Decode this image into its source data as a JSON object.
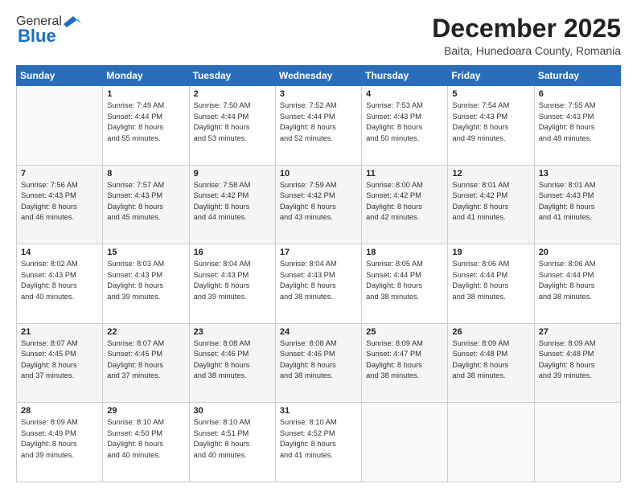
{
  "logo": {
    "line1": "General",
    "line2": "Blue"
  },
  "header": {
    "month": "December 2025",
    "location": "Baita, Hunedoara County, Romania"
  },
  "days_of_week": [
    "Sunday",
    "Monday",
    "Tuesday",
    "Wednesday",
    "Thursday",
    "Friday",
    "Saturday"
  ],
  "weeks": [
    [
      {
        "day": "",
        "info": ""
      },
      {
        "day": "1",
        "info": "Sunrise: 7:49 AM\nSunset: 4:44 PM\nDaylight: 8 hours\nand 55 minutes."
      },
      {
        "day": "2",
        "info": "Sunrise: 7:50 AM\nSunset: 4:44 PM\nDaylight: 8 hours\nand 53 minutes."
      },
      {
        "day": "3",
        "info": "Sunrise: 7:52 AM\nSunset: 4:44 PM\nDaylight: 8 hours\nand 52 minutes."
      },
      {
        "day": "4",
        "info": "Sunrise: 7:53 AM\nSunset: 4:43 PM\nDaylight: 8 hours\nand 50 minutes."
      },
      {
        "day": "5",
        "info": "Sunrise: 7:54 AM\nSunset: 4:43 PM\nDaylight: 8 hours\nand 49 minutes."
      },
      {
        "day": "6",
        "info": "Sunrise: 7:55 AM\nSunset: 4:43 PM\nDaylight: 8 hours\nand 48 minutes."
      }
    ],
    [
      {
        "day": "7",
        "info": "Sunrise: 7:56 AM\nSunset: 4:43 PM\nDaylight: 8 hours\nand 46 minutes."
      },
      {
        "day": "8",
        "info": "Sunrise: 7:57 AM\nSunset: 4:43 PM\nDaylight: 8 hours\nand 45 minutes."
      },
      {
        "day": "9",
        "info": "Sunrise: 7:58 AM\nSunset: 4:42 PM\nDaylight: 8 hours\nand 44 minutes."
      },
      {
        "day": "10",
        "info": "Sunrise: 7:59 AM\nSunset: 4:42 PM\nDaylight: 8 hours\nand 43 minutes."
      },
      {
        "day": "11",
        "info": "Sunrise: 8:00 AM\nSunset: 4:42 PM\nDaylight: 8 hours\nand 42 minutes."
      },
      {
        "day": "12",
        "info": "Sunrise: 8:01 AM\nSunset: 4:42 PM\nDaylight: 8 hours\nand 41 minutes."
      },
      {
        "day": "13",
        "info": "Sunrise: 8:01 AM\nSunset: 4:43 PM\nDaylight: 8 hours\nand 41 minutes."
      }
    ],
    [
      {
        "day": "14",
        "info": "Sunrise: 8:02 AM\nSunset: 4:43 PM\nDaylight: 8 hours\nand 40 minutes."
      },
      {
        "day": "15",
        "info": "Sunrise: 8:03 AM\nSunset: 4:43 PM\nDaylight: 8 hours\nand 39 minutes."
      },
      {
        "day": "16",
        "info": "Sunrise: 8:04 AM\nSunset: 4:43 PM\nDaylight: 8 hours\nand 39 minutes."
      },
      {
        "day": "17",
        "info": "Sunrise: 8:04 AM\nSunset: 4:43 PM\nDaylight: 8 hours\nand 38 minutes."
      },
      {
        "day": "18",
        "info": "Sunrise: 8:05 AM\nSunset: 4:44 PM\nDaylight: 8 hours\nand 38 minutes."
      },
      {
        "day": "19",
        "info": "Sunrise: 8:06 AM\nSunset: 4:44 PM\nDaylight: 8 hours\nand 38 minutes."
      },
      {
        "day": "20",
        "info": "Sunrise: 8:06 AM\nSunset: 4:44 PM\nDaylight: 8 hours\nand 38 minutes."
      }
    ],
    [
      {
        "day": "21",
        "info": "Sunrise: 8:07 AM\nSunset: 4:45 PM\nDaylight: 8 hours\nand 37 minutes."
      },
      {
        "day": "22",
        "info": "Sunrise: 8:07 AM\nSunset: 4:45 PM\nDaylight: 8 hours\nand 37 minutes."
      },
      {
        "day": "23",
        "info": "Sunrise: 8:08 AM\nSunset: 4:46 PM\nDaylight: 8 hours\nand 38 minutes."
      },
      {
        "day": "24",
        "info": "Sunrise: 8:08 AM\nSunset: 4:46 PM\nDaylight: 8 hours\nand 38 minutes."
      },
      {
        "day": "25",
        "info": "Sunrise: 8:09 AM\nSunset: 4:47 PM\nDaylight: 8 hours\nand 38 minutes."
      },
      {
        "day": "26",
        "info": "Sunrise: 8:09 AM\nSunset: 4:48 PM\nDaylight: 8 hours\nand 38 minutes."
      },
      {
        "day": "27",
        "info": "Sunrise: 8:09 AM\nSunset: 4:48 PM\nDaylight: 8 hours\nand 39 minutes."
      }
    ],
    [
      {
        "day": "28",
        "info": "Sunrise: 8:09 AM\nSunset: 4:49 PM\nDaylight: 8 hours\nand 39 minutes."
      },
      {
        "day": "29",
        "info": "Sunrise: 8:10 AM\nSunset: 4:50 PM\nDaylight: 8 hours\nand 40 minutes."
      },
      {
        "day": "30",
        "info": "Sunrise: 8:10 AM\nSunset: 4:51 PM\nDaylight: 8 hours\nand 40 minutes."
      },
      {
        "day": "31",
        "info": "Sunrise: 8:10 AM\nSunset: 4:52 PM\nDaylight: 8 hours\nand 41 minutes."
      },
      {
        "day": "",
        "info": ""
      },
      {
        "day": "",
        "info": ""
      },
      {
        "day": "",
        "info": ""
      }
    ]
  ]
}
